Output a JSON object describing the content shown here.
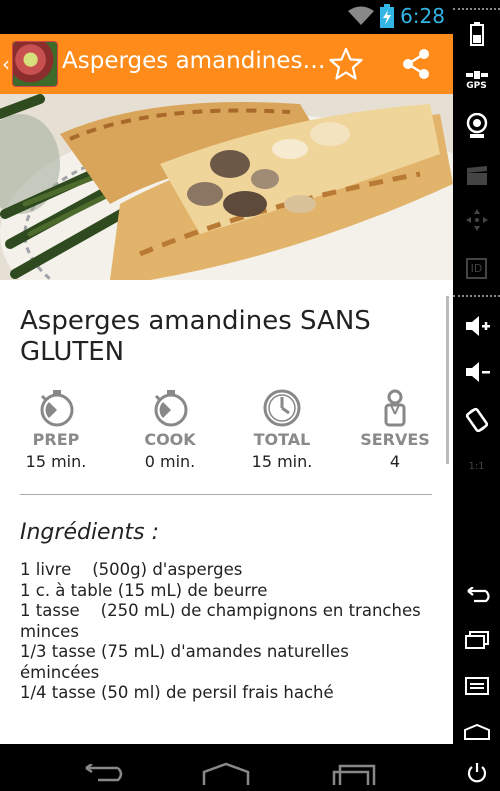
{
  "status_bar": {
    "time": "6:28"
  },
  "action_bar": {
    "title": "Asperges amandines SANS GLUTEN",
    "back_glyph": "‹"
  },
  "recipe": {
    "title": "Asperges amandines SANS GLUTEN",
    "stats": [
      {
        "label": "PREP",
        "value": "15 min.",
        "icon": "stopwatch-icon"
      },
      {
        "label": "COOK",
        "value": "0 min.",
        "icon": "stopwatch-icon"
      },
      {
        "label": "TOTAL",
        "value": "15 min.",
        "icon": "clock-icon"
      },
      {
        "label": "SERVES",
        "value": "4",
        "icon": "chef-icon"
      }
    ],
    "ingredients_heading": "Ingrédients :",
    "ingredients": [
      "1 livre    (500g) d'asperges",
      "1 c. à table (15 mL) de beurre",
      "1 tasse    (250 mL) de champignons en tranches minces",
      "1/3 tasse (75 mL) d'amandes naturelles émincées",
      "1/4 tasse (50 ml) de persil frais haché"
    ]
  },
  "side_panel": {
    "gps_label": "GPS",
    "id_label": "ID",
    "ratio_label": "1:1"
  },
  "colors": {
    "action_bar": "#ff8c1a",
    "clock": "#33b5e5"
  }
}
